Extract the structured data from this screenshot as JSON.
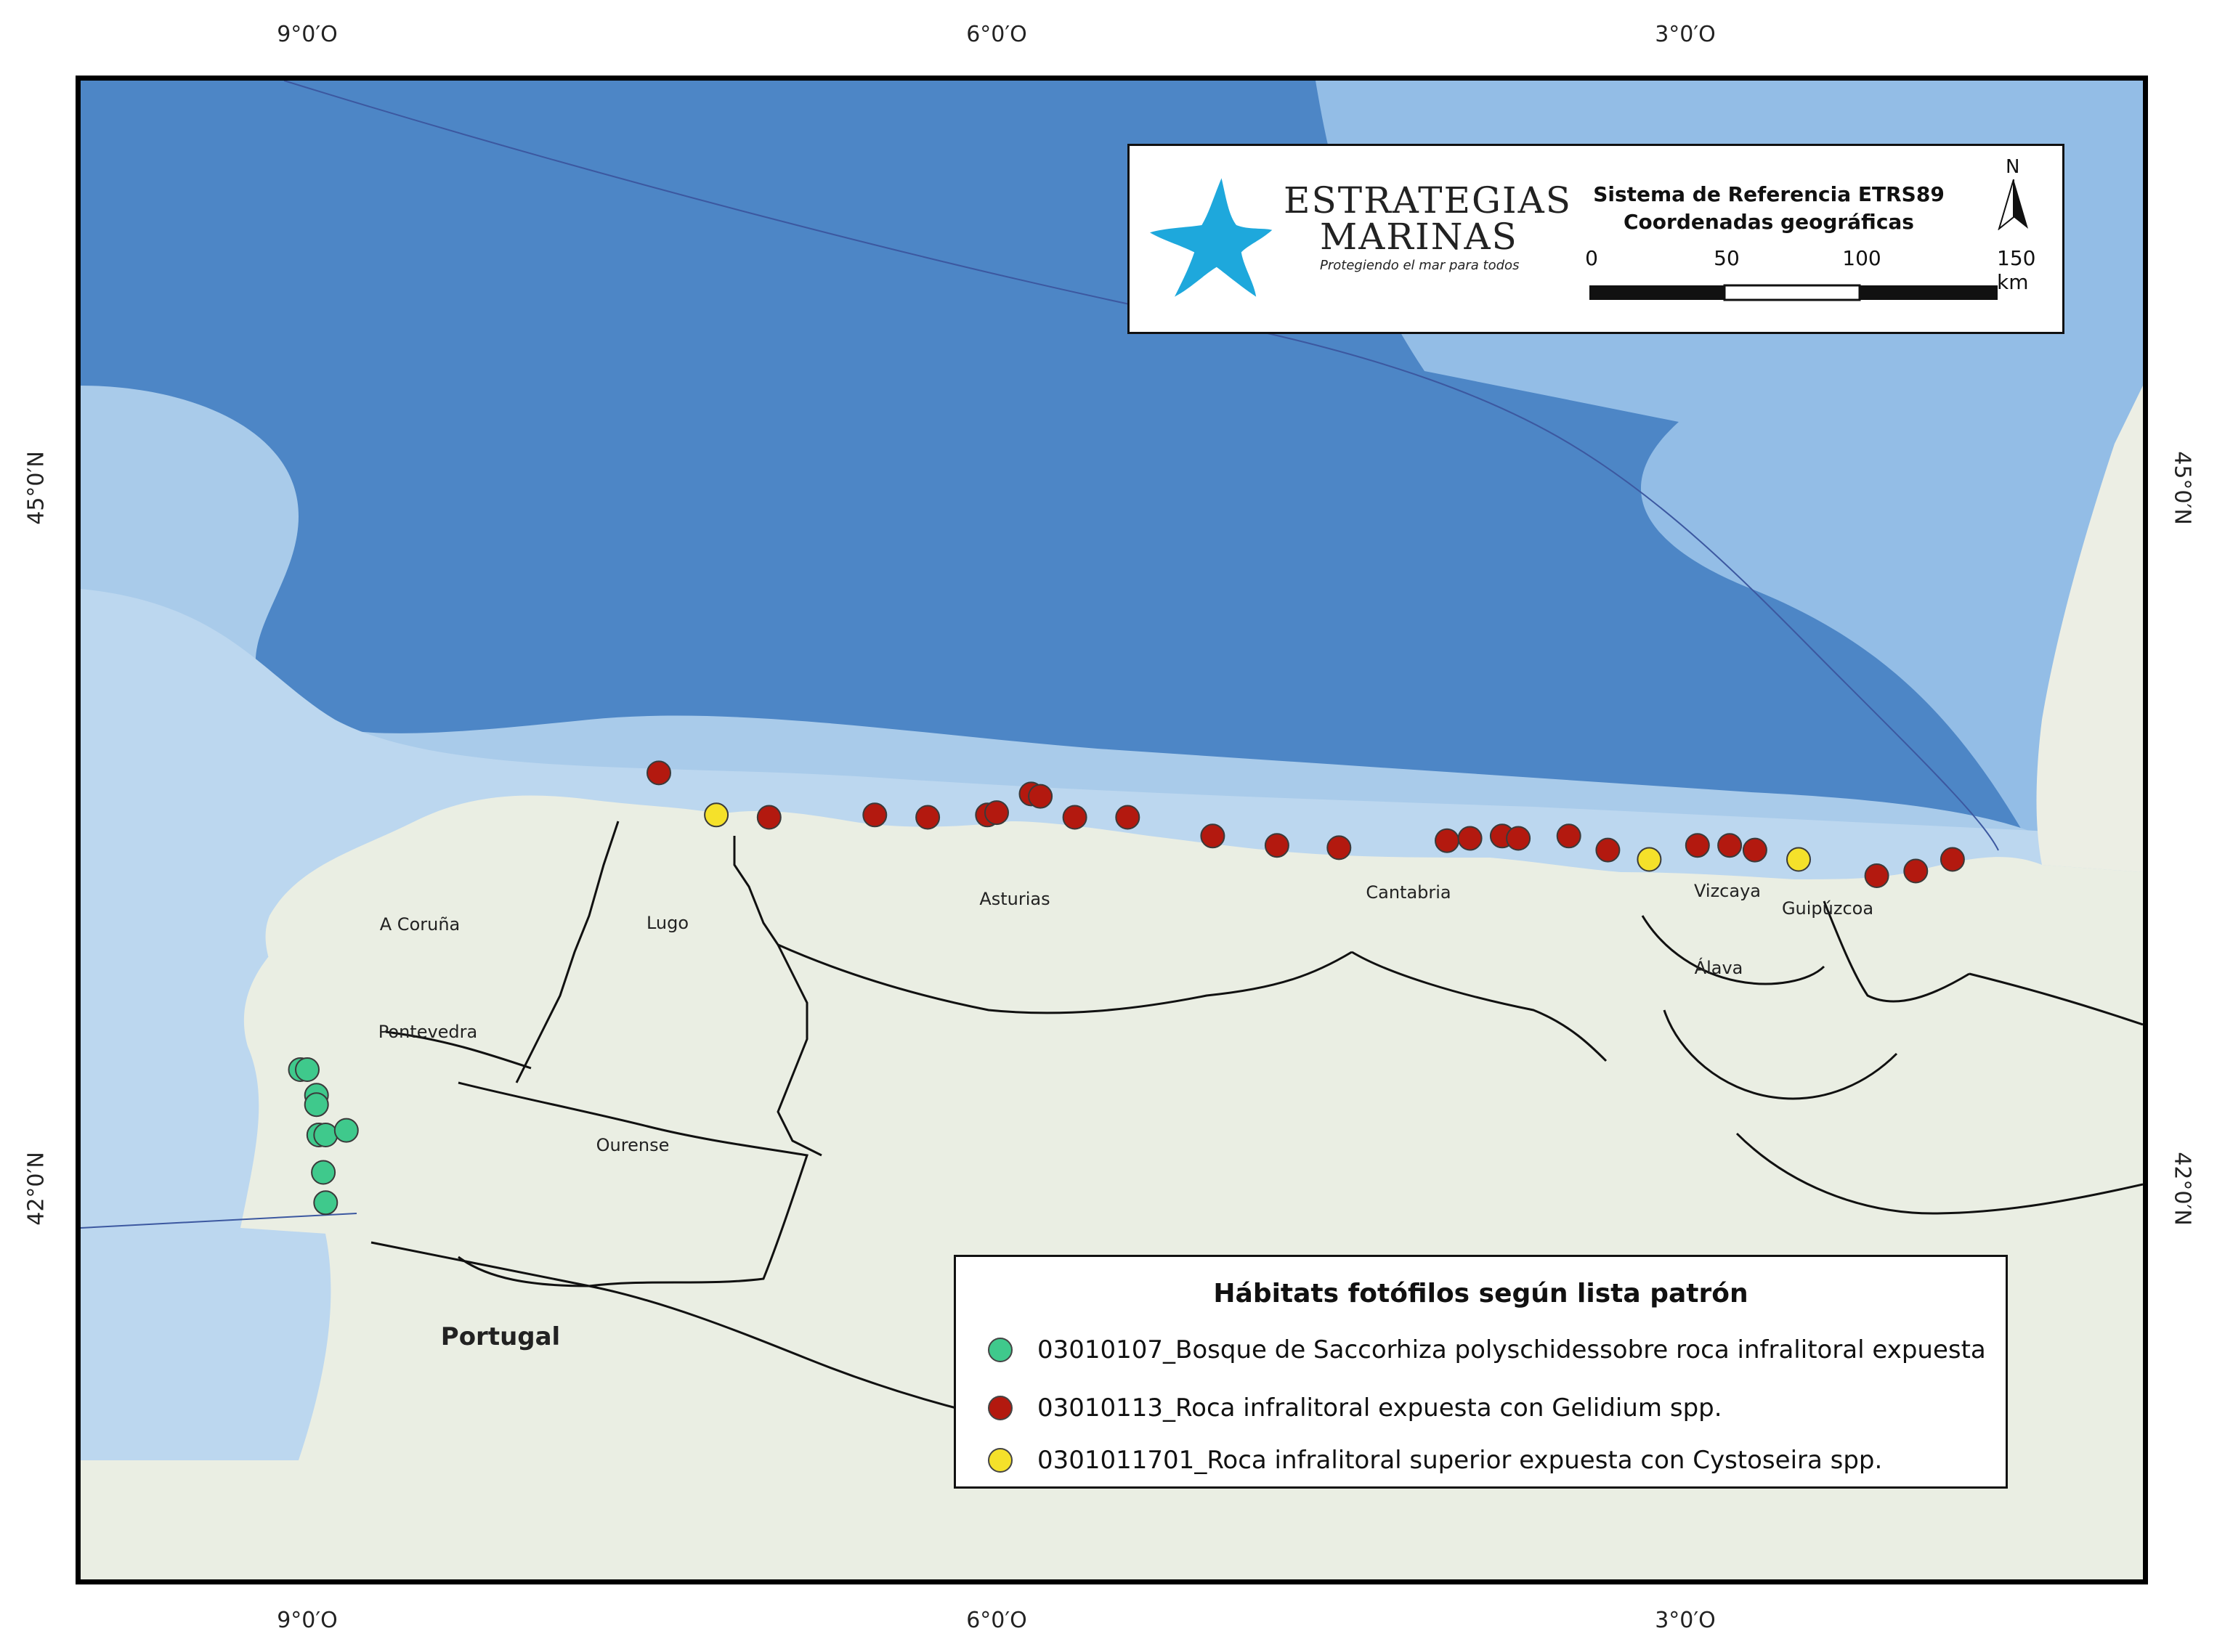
{
  "axis_ticks": {
    "top": [
      "9°0′O",
      "6°0′O",
      "3°0′O"
    ],
    "bottom": [
      "9°0′O",
      "6°0′O",
      "3°0′O"
    ],
    "left": [
      "45°0′N",
      "42°0′N"
    ],
    "right": [
      "45°0′N",
      "42°0′N"
    ]
  },
  "logo": {
    "line1": "ESTRATEGIAS",
    "line2": "MARINAS",
    "tagline": "Protegiendo el mar para todos",
    "color": "#1ea8dc"
  },
  "reference": {
    "line1": "Sistema de Referencia ETRS89",
    "line2": "Coordenadas geográficas",
    "north": "N",
    "scale_labels": [
      "0",
      "50",
      "100",
      "150 km"
    ]
  },
  "places": {
    "coruna": "A Coruña",
    "lugo": "Lugo",
    "asturias": "Asturias",
    "cantabria": "Cantabria",
    "vizcaya": "Vizcaya",
    "guipuzcoa": "Guipúzcoa",
    "alava": "Álava",
    "pontevedra": "Pontevedra",
    "ourense": "Ourense",
    "portugal": "Portugal"
  },
  "legend": {
    "title": "Hábitats fotófilos según lista patrón",
    "items": [
      {
        "label": "03010107_Bosque de Saccorhiza polyschidessobre roca infralitoral expuesta",
        "color": "#3fc98c"
      },
      {
        "label": "03010113_Roca infralitoral expuesta con Gelidium spp.",
        "color": "#b3190f"
      },
      {
        "label": "0301011701_Roca infralitoral superior expuesta con Cystoseira spp.",
        "color": "#f5e12a"
      }
    ]
  },
  "colors": {
    "deep_sea": "#4a82c2",
    "shelf_sea": "#a9cbea",
    "land": "#eaeee3",
    "border": "#111111"
  },
  "sites": {
    "green": [
      [
        -9.03,
        42.51
      ],
      [
        -9.0,
        42.51
      ],
      [
        -8.96,
        42.4
      ],
      [
        -8.96,
        42.36
      ],
      [
        -8.95,
        42.23
      ],
      [
        -8.92,
        42.23
      ],
      [
        -8.83,
        42.25
      ],
      [
        -8.93,
        42.07
      ],
      [
        -8.92,
        41.94
      ]
    ],
    "red": [
      [
        -7.47,
        43.78
      ],
      [
        -6.99,
        43.59
      ],
      [
        -6.53,
        43.6
      ],
      [
        -6.3,
        43.59
      ],
      [
        -6.04,
        43.6
      ],
      [
        -6.0,
        43.61
      ],
      [
        -5.85,
        43.69
      ],
      [
        -5.81,
        43.68
      ],
      [
        -5.66,
        43.59
      ],
      [
        -5.43,
        43.59
      ],
      [
        -5.06,
        43.51
      ],
      [
        -4.78,
        43.47
      ],
      [
        -4.51,
        43.46
      ],
      [
        -4.04,
        43.49
      ],
      [
        -3.94,
        43.5
      ],
      [
        -3.8,
        43.51
      ],
      [
        -3.73,
        43.5
      ],
      [
        -3.51,
        43.51
      ],
      [
        -3.34,
        43.45
      ],
      [
        -2.95,
        43.47
      ],
      [
        -2.81,
        43.47
      ],
      [
        -2.7,
        43.45
      ],
      [
        -2.17,
        43.34
      ],
      [
        -2.0,
        43.36
      ],
      [
        -1.84,
        43.41
      ]
    ],
    "yellow": [
      [
        -7.22,
        43.6
      ],
      [
        -3.16,
        43.41
      ],
      [
        -2.51,
        43.41
      ]
    ]
  }
}
